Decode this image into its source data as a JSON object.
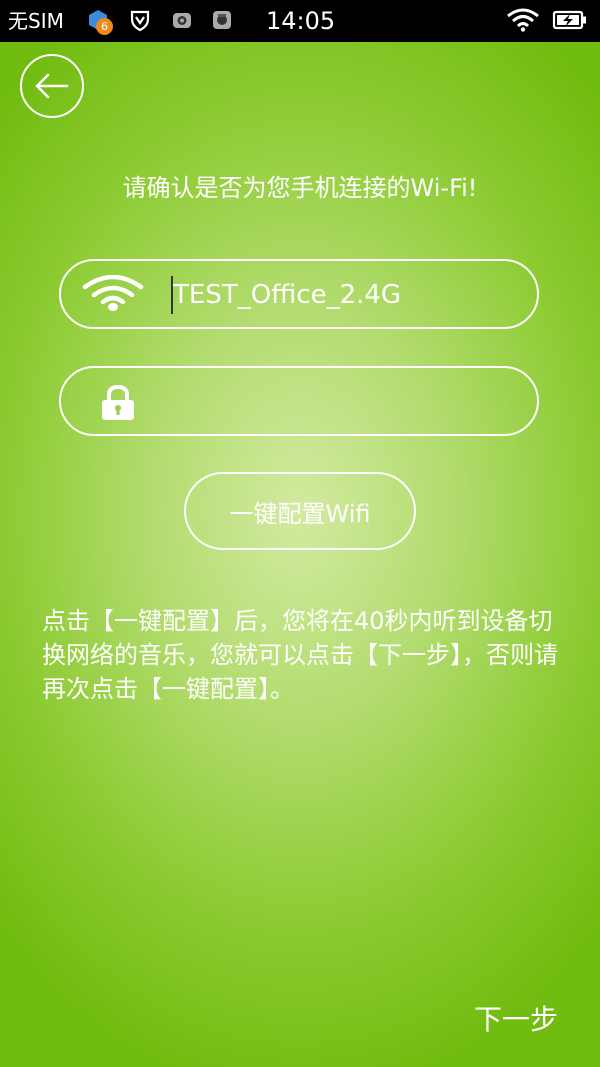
{
  "status_bar": {
    "carrier": "无SIM",
    "time": "14:05",
    "badge_count": "6",
    "icons": [
      "app-notification-icon",
      "shield-icon",
      "camera-icon",
      "gallery-icon",
      "wifi-signal-icon",
      "battery-charging-icon"
    ]
  },
  "header": {
    "back_icon": "back-arrow-icon"
  },
  "main": {
    "title": "请确认是否为您手机连接的Wi-Fi!",
    "ssid_field": {
      "icon": "wifi-icon",
      "value": "TEST_Office_2.4G"
    },
    "password_field": {
      "icon": "lock-icon",
      "value": "",
      "placeholder": ""
    },
    "config_button_label": "一键配置Wifi",
    "instructions": "点击【一键配置】后，您将在40秒内听到设备切换网络的音乐，您就可以点击【下一步】，否则请再次点击【一键配置】。"
  },
  "footer": {
    "next_label": "下一步"
  },
  "colors": {
    "background_edge": "#71bc10",
    "background_center": "#d3eaa0",
    "status_bar": "#000000",
    "foreground": "#ffffff",
    "badge": "#f08a1c"
  }
}
